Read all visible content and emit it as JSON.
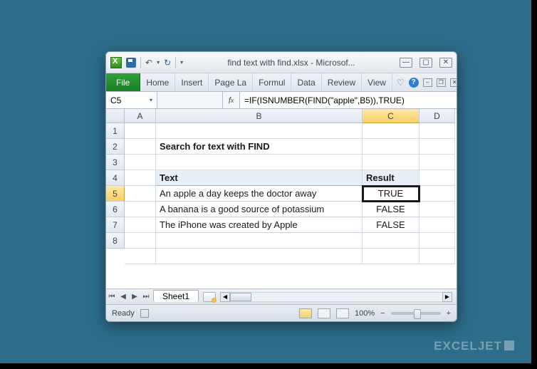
{
  "window": {
    "title": "find text with find.xlsx - Microsof..."
  },
  "ribbon": {
    "file": "File",
    "tabs": [
      "Home",
      "Insert",
      "Page La",
      "Formul",
      "Data",
      "Review",
      "View"
    ]
  },
  "namebox": "C5",
  "formula": "=IF(ISNUMBER(FIND(\"apple\",B5)),TRUE)",
  "columns": [
    "A",
    "B",
    "C",
    "D"
  ],
  "rows": [
    "1",
    "2",
    "3",
    "4",
    "5",
    "6",
    "7",
    "8"
  ],
  "sheet": {
    "b2": "Search for text with FIND",
    "b4": "Text",
    "c4": "Result",
    "b5": "An apple a day keeps the doctor away",
    "c5": "TRUE",
    "b6": "A banana is a good source of potassium",
    "c6": "FALSE",
    "b7": "The iPhone was created by Apple",
    "c7": "FALSE"
  },
  "tabs": {
    "sheet1": "Sheet1"
  },
  "status": {
    "ready": "Ready",
    "zoom": "100%"
  },
  "zoom_controls": {
    "minus": "−",
    "plus": "+"
  },
  "watermark": "EXCELJET"
}
